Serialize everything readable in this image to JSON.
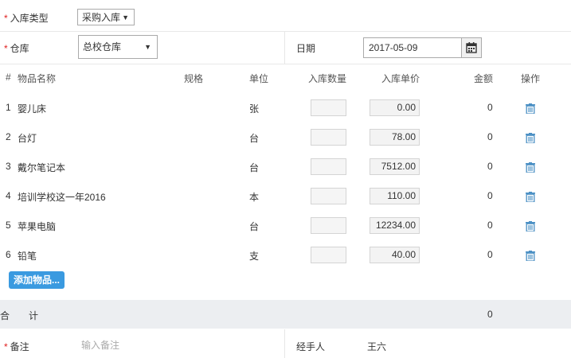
{
  "form": {
    "entry_type_label": "入库类型",
    "entry_type_value": "采购入库",
    "warehouse_label": "仓库",
    "warehouse_value": "总校仓库",
    "date_label": "日期",
    "date_value": "2017-05-09"
  },
  "table": {
    "headers": [
      "#",
      "物品名称",
      "规格",
      "单位",
      "入库数量",
      "入库单价",
      "金额",
      "操作"
    ],
    "rows": [
      {
        "index": "1",
        "name": "婴儿床",
        "spec": "",
        "unit": "张",
        "qty": "",
        "price": "0.00",
        "amount": "0"
      },
      {
        "index": "2",
        "name": "台灯",
        "spec": "",
        "unit": "台",
        "qty": "",
        "price": "78.00",
        "amount": "0"
      },
      {
        "index": "3",
        "name": "戴尔笔记本",
        "spec": "",
        "unit": "台",
        "qty": "",
        "price": "7512.00",
        "amount": "0"
      },
      {
        "index": "4",
        "name": "培训学校这一年2016",
        "spec": "",
        "unit": "本",
        "qty": "",
        "price": "110.00",
        "amount": "0"
      },
      {
        "index": "5",
        "name": "苹果电脑",
        "spec": "",
        "unit": "台",
        "qty": "",
        "price": "12234.00",
        "amount": "0"
      },
      {
        "index": "6",
        "name": "铅笔",
        "spec": "",
        "unit": "支",
        "qty": "",
        "price": "40.00",
        "amount": "0"
      }
    ],
    "add_button_label": "添加物品..."
  },
  "total": {
    "label_left": "合",
    "label_right": "计",
    "amount": "0"
  },
  "footer": {
    "remark_label": "备注",
    "remark_placeholder": "输入备注",
    "handler_label": "经手人",
    "handler_value": "王六"
  },
  "colors": {
    "accent": "#3a9ae0",
    "required": "#e02020",
    "trash": "#4a8fc4"
  },
  "icons": {
    "dropdown": "triangle-down",
    "calendar": "calendar-icon",
    "delete": "trash-icon"
  }
}
